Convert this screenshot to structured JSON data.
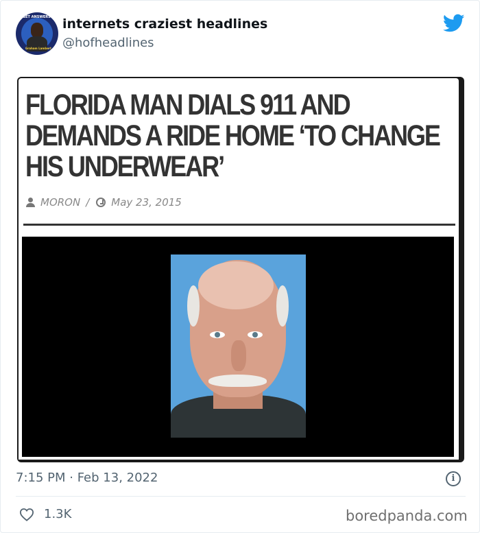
{
  "author": {
    "display_name": "internets craziest headlines",
    "handle": "@hofheadlines",
    "avatar_caption_top": "GET ANSWERS!",
    "avatar_caption_bottom": "Graham Lambert"
  },
  "brand": {
    "icon": "twitter-bird-icon",
    "color": "#1d9bf0"
  },
  "article": {
    "headline": "FLORIDA MAN DIALS 911 AND DEMANDS A RIDE HOME ‘TO CHANGE HIS UNDERWEAR’",
    "category": "MORON",
    "separator": "/",
    "date": "May 23, 2015",
    "image": "mugshot-photo"
  },
  "footer": {
    "timestamp": "7:15 PM · Feb 13, 2022",
    "likes": "1.3K",
    "info_icon": "i"
  },
  "watermark": "boredpanda.com",
  "colors": {
    "text_secondary": "#536471",
    "headline": "#333333"
  }
}
